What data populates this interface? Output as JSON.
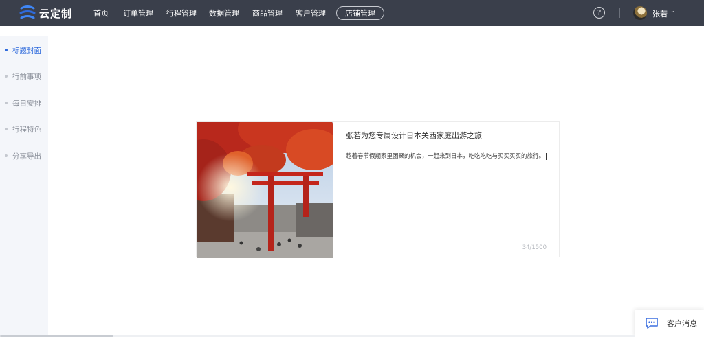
{
  "app": {
    "logo_text": "云定制"
  },
  "nav": {
    "items": [
      {
        "label": "首页"
      },
      {
        "label": "订单管理"
      },
      {
        "label": "行程管理"
      },
      {
        "label": "数据管理"
      },
      {
        "label": "商品管理"
      },
      {
        "label": "客户管理"
      }
    ],
    "store_label": "店铺管理"
  },
  "header": {
    "help_glyph": "?",
    "user_name": "张若",
    "user_caret": "⌄"
  },
  "sidebar": {
    "items": [
      {
        "label": "标题封面",
        "active": true
      },
      {
        "label": "行前事项",
        "active": false
      },
      {
        "label": "每日安排",
        "active": false
      },
      {
        "label": "行程特色",
        "active": false
      },
      {
        "label": "分享导出",
        "active": false
      }
    ]
  },
  "cover_card": {
    "title": "张若为您专属设计日本关西家庭出游之旅",
    "description": "趁着春节假期家里团聚的机会，一起来到日本，吃吃吃吃与买买买买的旅行。",
    "char_count": "34/1500"
  },
  "chat": {
    "label": "客户消息"
  },
  "colors": {
    "accent": "#2f6bdc",
    "topbar": "#3a3f4b",
    "sidebar_bg": "#f4f6fa"
  },
  "icons": [
    "logo-icon",
    "help-icon",
    "chevron-down-icon",
    "chat-icon"
  ]
}
